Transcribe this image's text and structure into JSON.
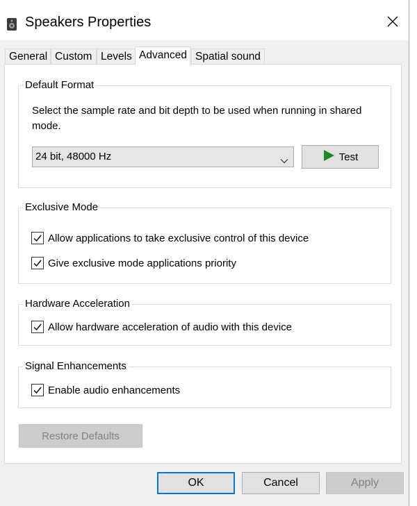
{
  "window": {
    "title": "Speakers Properties",
    "icon": "speaker-icon",
    "close_icon": "close-icon"
  },
  "tabs": [
    {
      "label": "General"
    },
    {
      "label": "Custom"
    },
    {
      "label": "Levels"
    },
    {
      "label": "Advanced",
      "active": true
    },
    {
      "label": "Spatial sound"
    }
  ],
  "default_format": {
    "title": "Default Format",
    "description": "Select the sample rate and bit depth to be used when running in shared mode.",
    "selected_format": "24 bit, 48000 Hz",
    "test_label": "Test"
  },
  "exclusive_mode": {
    "title": "Exclusive Mode",
    "allow_exclusive": {
      "label": "Allow applications to take exclusive control of this device",
      "checked": true
    },
    "priority": {
      "label": "Give exclusive mode applications priority",
      "checked": true
    }
  },
  "hardware_acceleration": {
    "title": "Hardware Acceleration",
    "allow_hw": {
      "label": "Allow hardware acceleration of audio with this device",
      "checked": true
    }
  },
  "signal_enhancements": {
    "title": "Signal Enhancements",
    "enable": {
      "label": "Enable audio enhancements",
      "checked": true
    }
  },
  "restore_defaults_label": "Restore Defaults",
  "buttons": {
    "ok": "OK",
    "cancel": "Cancel",
    "apply": "Apply"
  },
  "colors": {
    "test_play": "#1e8a1e",
    "ok_border": "#0078d7"
  }
}
